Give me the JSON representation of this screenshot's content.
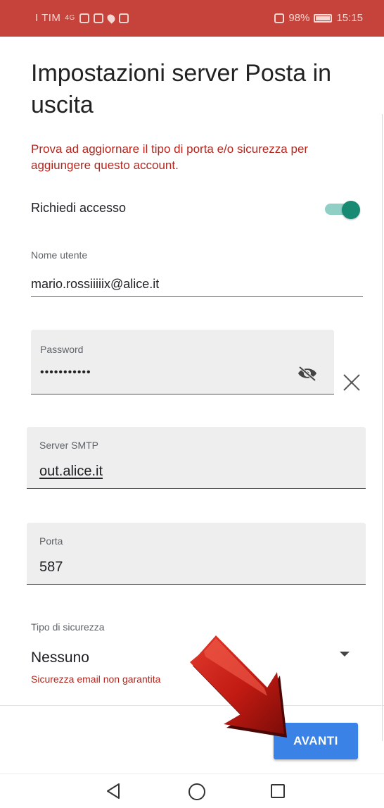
{
  "status_bar": {
    "carrier": "I TIM",
    "network": "4G",
    "battery_percent": "98%",
    "time": "15:15"
  },
  "page": {
    "title": "Impostazioni server Posta in uscita",
    "error_message": "Prova ad aggiornare il tipo di porta e/o sicurezza per aggiungere questo account."
  },
  "login_toggle": {
    "label": "Richiedi accesso",
    "enabled": true,
    "accent": "#188a73"
  },
  "username": {
    "label": "Nome utente",
    "value": "mario.rossiiiiix@alice.it"
  },
  "password": {
    "label": "Password",
    "value": "•••••••••••"
  },
  "smtp_server": {
    "label": "Server SMTP",
    "value": "out.alice.it"
  },
  "port": {
    "label": "Porta",
    "value": "587"
  },
  "security": {
    "label": "Tipo di sicurezza",
    "selected": "Nessuno",
    "warning": "Sicurezza email non garantita"
  },
  "footer": {
    "next_label": "AVANTI",
    "button_color": "#3b82e6"
  },
  "icons": {
    "password_visibility": "eye-off-icon",
    "clear": "close-icon",
    "dropdown": "triangle-down-icon",
    "nav_back": "back-triangle-icon",
    "nav_home": "home-circle-icon",
    "nav_recent": "recent-square-icon"
  },
  "colors": {
    "status_bar": "#c5433b",
    "error": "#b3261e"
  }
}
